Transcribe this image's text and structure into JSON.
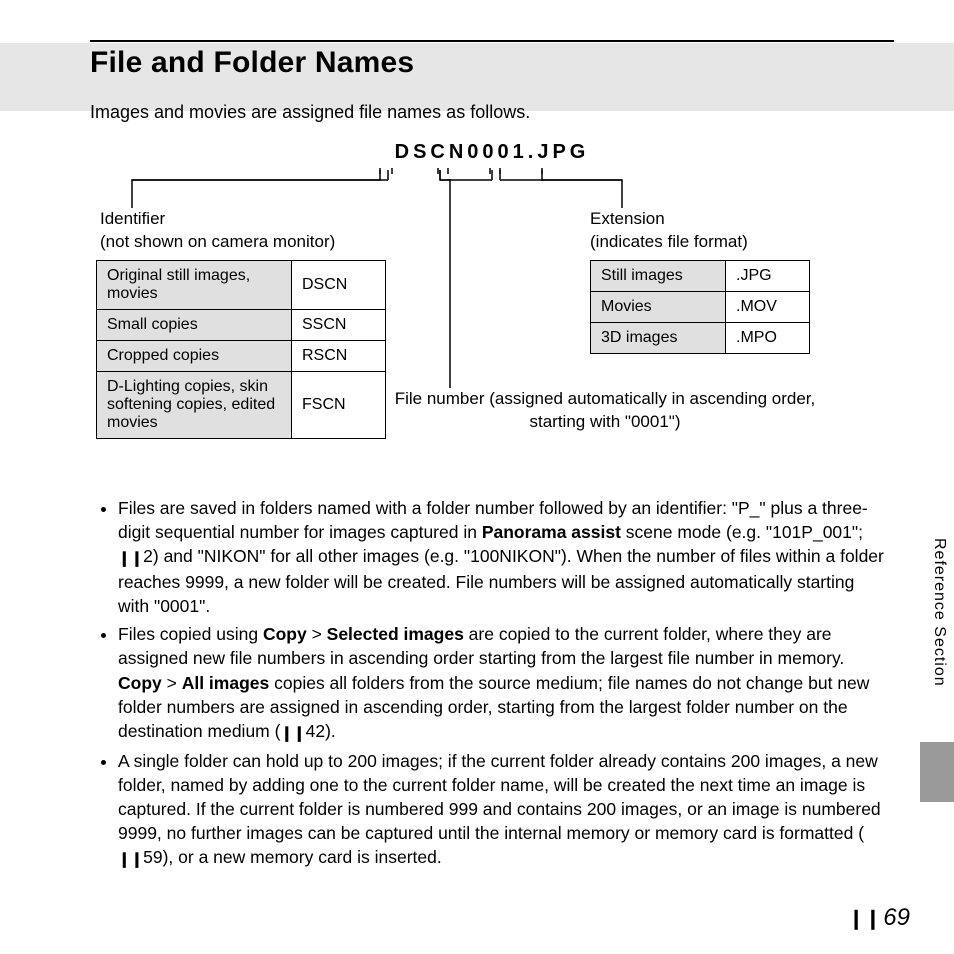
{
  "title": "File and Folder Names",
  "intro": "Images and movies are assigned file names as follows.",
  "example_filename": "DSCN0001.JPG",
  "identifier": {
    "heading": "Identifier",
    "sub": "(not shown on camera monitor)",
    "rows": [
      {
        "label": "Original still images, movies",
        "code": "DSCN"
      },
      {
        "label": "Small copies",
        "code": "SSCN"
      },
      {
        "label": "Cropped copies",
        "code": "RSCN"
      },
      {
        "label": "D-Lighting copies, skin softening copies, edited movies",
        "code": "FSCN"
      }
    ]
  },
  "extension": {
    "heading": "Extension",
    "sub": "(indicates file format)",
    "rows": [
      {
        "label": "Still images",
        "code": ".JPG"
      },
      {
        "label": "Movies",
        "code": ".MOV"
      },
      {
        "label": "3D images",
        "code": ".MPO"
      }
    ]
  },
  "file_number_label": "File number (assigned automatically in ascending order, starting with \"0001\")",
  "bullets": {
    "b1_a": "Files are saved in folders named with a folder number followed by an identifier: \"P_\" plus a three-digit sequential number for images captured in ",
    "b1_bold1": "Panorama assist",
    "b1_b": " scene mode (e.g. \"101P_001\"; ",
    "b1_ref1": "2",
    "b1_c": ") and \"NIKON\" for all other images (e.g. \"100NIKON\"). When the number of files within a folder reaches 9999, a new folder will be created. File numbers will be assigned automatically starting with \"0001\".",
    "b2_a": "Files copied using ",
    "b2_bold1": "Copy",
    "b2_gt1": " > ",
    "b2_bold2": "Selected images",
    "b2_b": " are copied to the current folder, where they are assigned new file numbers in ascending order starting from the largest file number in memory. ",
    "b2_bold3": "Copy",
    "b2_gt2": " > ",
    "b2_bold4": "All images",
    "b2_c": " copies all folders from the source medium; file names do not change but new folder numbers are assigned in ascending order, starting from the largest folder number on the destination medium (",
    "b2_ref1": "42",
    "b2_d": ").",
    "b3_a": "A single folder can hold up to 200 images; if the current folder already contains 200 images, a new folder, named by adding one to the current folder name, will be created the next time an image is captured. If the current folder is numbered 999 and contains 200 images, or an image is numbered 9999, no further images can be captured until the internal memory or memory card is formatted (",
    "b3_ref1": "59",
    "b3_b": "), or a new memory card is inserted."
  },
  "side_label": "Reference Section",
  "page_number": "69"
}
